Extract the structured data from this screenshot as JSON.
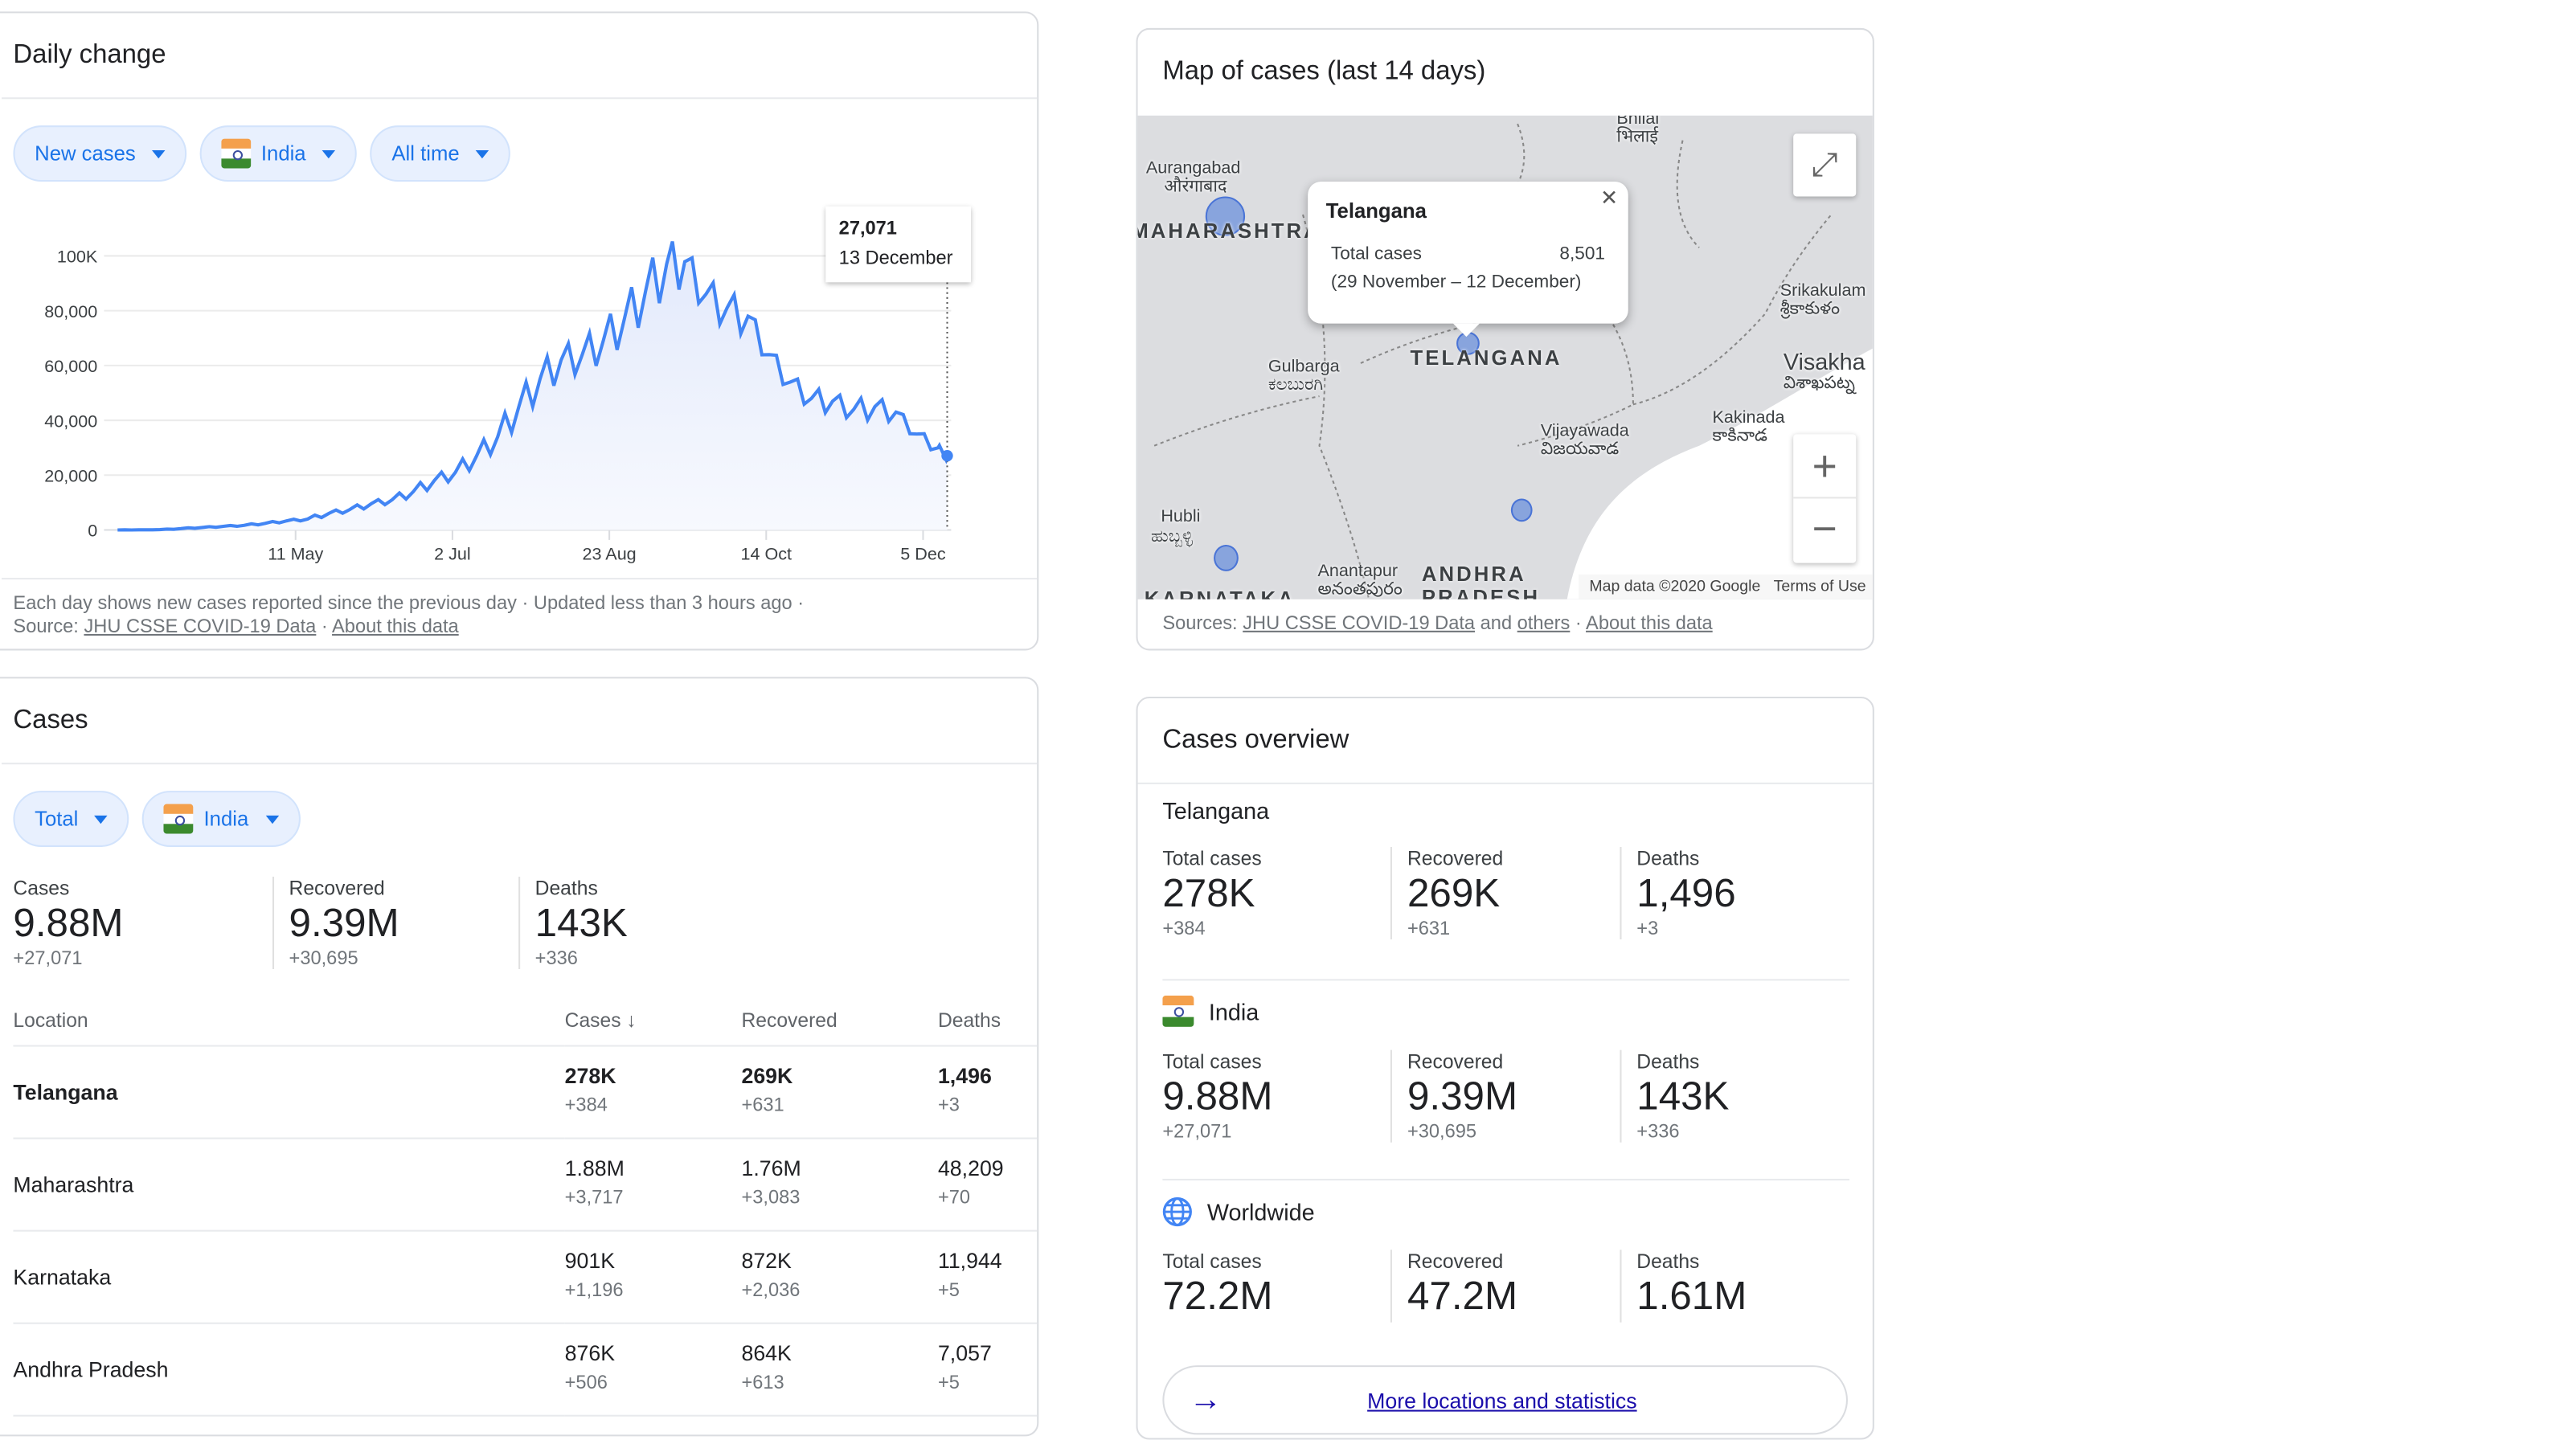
{
  "daily": {
    "title": "Daily change",
    "chips": [
      "New cases",
      "India",
      "All time"
    ],
    "tooltip": {
      "value": "27,071",
      "date": "13 December"
    },
    "footer_line1": "Each day shows new cases reported since the previous day · Updated less than 3 hours ago ·",
    "source_prefix": "Source:",
    "source_link": "JHU CSSE COVID-19 Data",
    "about_link": "About this data"
  },
  "chart_data": {
    "type": "area",
    "title": "",
    "xlabel": "",
    "ylabel": "",
    "ylim": [
      0,
      100000
    ],
    "yticks": [
      "0",
      "20,000",
      "40,000",
      "60,000",
      "80,000",
      "100K"
    ],
    "xticks": [
      "11 May",
      "2 Jul",
      "23 Aug",
      "14 Oct",
      "5 Dec"
    ],
    "grid": true,
    "color": "#4285f4",
    "x": [
      "13 Mar",
      "20 Mar",
      "27 Mar",
      "3 Apr",
      "10 Apr",
      "17 Apr",
      "24 Apr",
      "1 May",
      "8 May",
      "15 May",
      "22 May",
      "29 May",
      "5 Jun",
      "12 Jun",
      "19 Jun",
      "26 Jun",
      "3 Jul",
      "10 Jul",
      "17 Jul",
      "24 Jul",
      "31 Jul",
      "7 Aug",
      "14 Aug",
      "21 Aug",
      "28 Aug",
      "4 Sep",
      "11 Sep",
      "17 Sep",
      "24 Sep",
      "1 Oct",
      "8 Oct",
      "15 Oct",
      "22 Oct",
      "29 Oct",
      "5 Nov",
      "12 Nov",
      "19 Nov",
      "26 Nov",
      "3 Dec",
      "10 Dec",
      "13 Dec"
    ],
    "values": [
      10,
      50,
      100,
      500,
      900,
      1300,
      1700,
      2400,
      3300,
      4000,
      6000,
      7500,
      9500,
      11000,
      14000,
      18000,
      21000,
      27000,
      34000,
      45000,
      55000,
      62000,
      64000,
      69000,
      77000,
      87000,
      97000,
      97900,
      86000,
      81000,
      78000,
      64000,
      54000,
      48000,
      47000,
      44000,
      45000,
      43000,
      35000,
      30000,
      27071
    ]
  },
  "map": {
    "title": "Map of cases (last 14 days)",
    "popup": {
      "title": "Telangana",
      "label": "Total cases",
      "value": "8,501",
      "range": "(29 November – 12 December)"
    },
    "labels": [
      "Aurangabad",
      "औरंगाबाद",
      "Bhilai",
      "भिलाई",
      "Gulbarga",
      "ಕಲಬುರಗಿ",
      "Vijayawada",
      "విజయవాడ",
      "Kakinada",
      "కాకినాడ",
      "Srikakulam",
      "శ్రీకాకుళం",
      "Visakha",
      "విశాఖపట్న",
      "Hubli",
      "ಹುಬ್ಬಳ್ಳಿ",
      "Anantapur",
      "అనంతపురం"
    ],
    "regions": [
      "MAHARASHTRA",
      "TELANGANA",
      "ANDHRA",
      "PRADESH",
      "KARNATAKA"
    ],
    "attribution": "Map data ©2020 Google",
    "terms": "Terms of Use",
    "sources_prefix": "Sources:",
    "sources_link": "JHU CSSE COVID-19 Data",
    "and": "and",
    "others": "others",
    "about_link": "About this data"
  },
  "cases": {
    "title": "Cases",
    "chips": [
      "Total",
      "India"
    ],
    "stats": [
      {
        "label": "Cases",
        "value": "9.88M",
        "delta": "+27,071"
      },
      {
        "label": "Recovered",
        "value": "9.39M",
        "delta": "+30,695"
      },
      {
        "label": "Deaths",
        "value": "143K",
        "delta": "+336"
      }
    ],
    "columns": [
      "Location",
      "Cases",
      "Recovered",
      "Deaths"
    ],
    "rows": [
      {
        "location": "Telangana",
        "cases": "278K",
        "cases_d": "+384",
        "rec": "269K",
        "rec_d": "+631",
        "deaths": "1,496",
        "deaths_d": "+3"
      },
      {
        "location": "Maharashtra",
        "cases": "1.88M",
        "cases_d": "+3,717",
        "rec": "1.76M",
        "rec_d": "+3,083",
        "deaths": "48,209",
        "deaths_d": "+70"
      },
      {
        "location": "Karnataka",
        "cases": "901K",
        "cases_d": "+1,196",
        "rec": "872K",
        "rec_d": "+2,036",
        "deaths": "11,944",
        "deaths_d": "+5"
      },
      {
        "location": "Andhra Pradesh",
        "cases": "876K",
        "cases_d": "+506",
        "rec": "864K",
        "rec_d": "+613",
        "deaths": "7,057",
        "deaths_d": "+5"
      }
    ]
  },
  "overview": {
    "title": "Cases overview",
    "sections": [
      {
        "name": "Telangana",
        "labels": [
          "Total cases",
          "Recovered",
          "Deaths"
        ],
        "values": [
          "278K",
          "269K",
          "1,496"
        ],
        "deltas": [
          "+384",
          "+631",
          "+3"
        ]
      },
      {
        "name": "India",
        "labels": [
          "Total cases",
          "Recovered",
          "Deaths"
        ],
        "values": [
          "9.88M",
          "9.39M",
          "143K"
        ],
        "deltas": [
          "+27,071",
          "+30,695",
          "+336"
        ]
      },
      {
        "name": "Worldwide",
        "labels": [
          "Total cases",
          "Recovered",
          "Deaths"
        ],
        "values": [
          "72.2M",
          "47.2M",
          "1.61M"
        ]
      }
    ],
    "more_link": "More locations and statistics"
  }
}
